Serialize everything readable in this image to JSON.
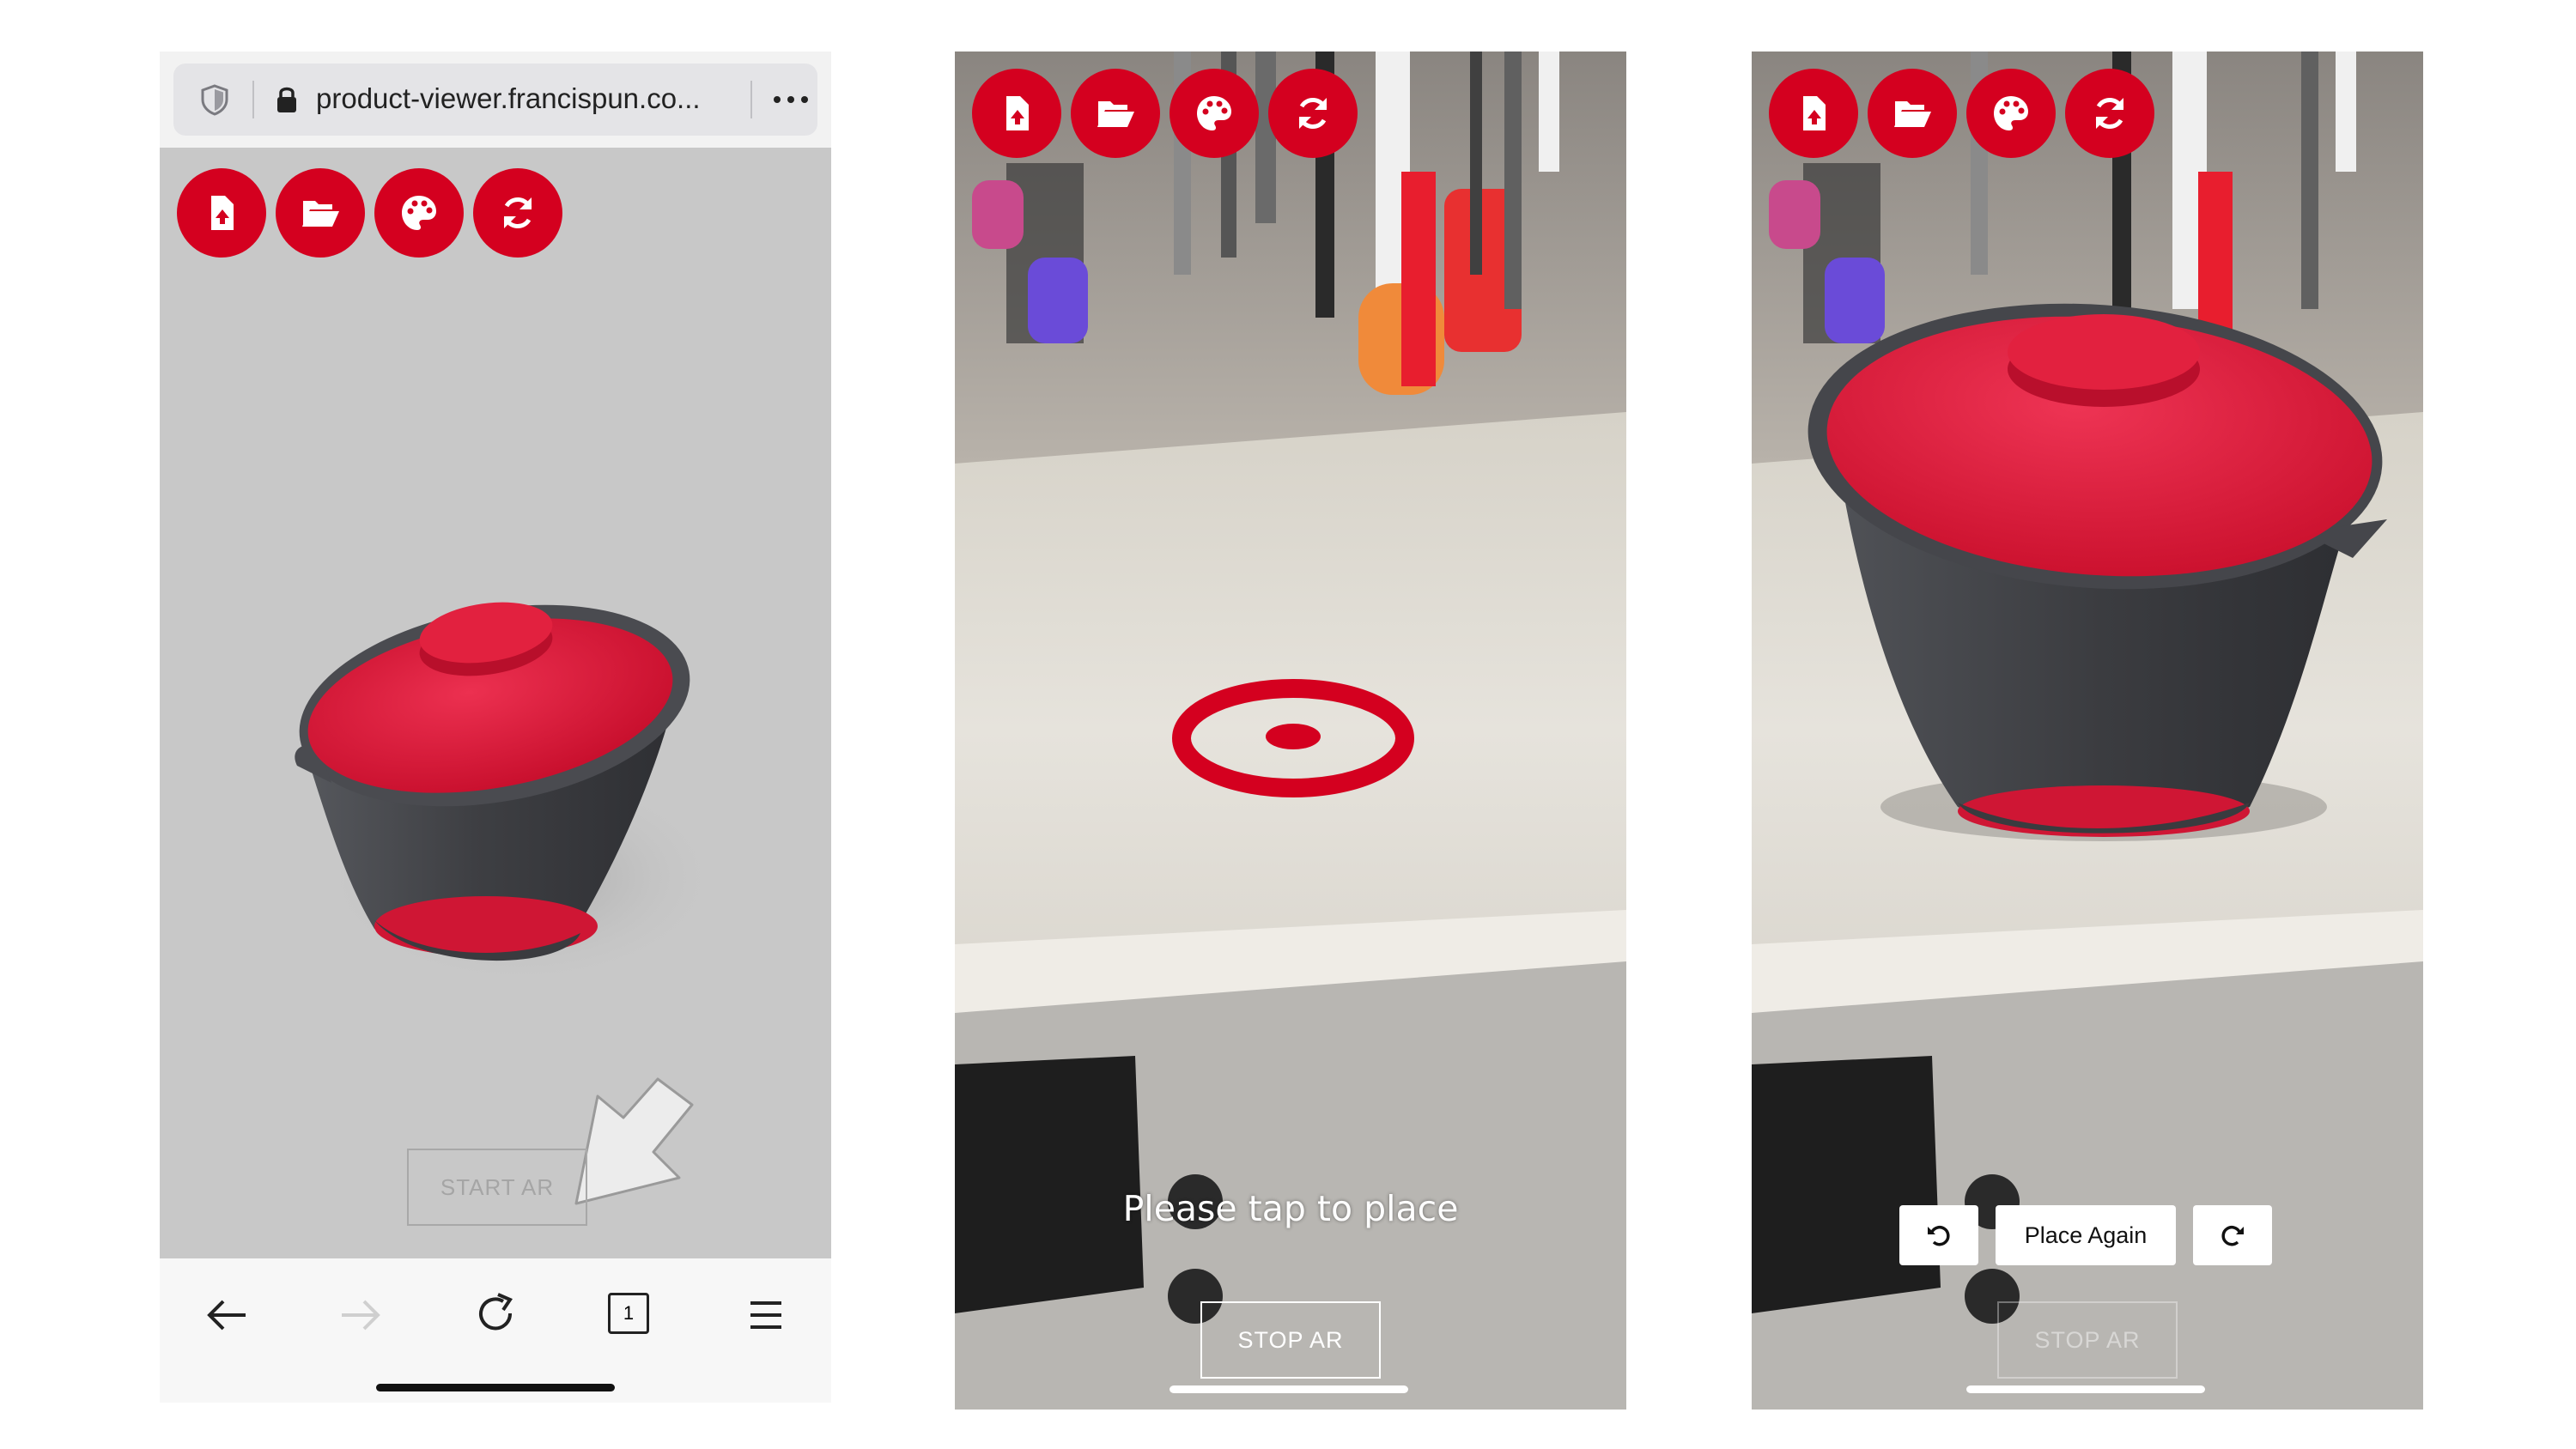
{
  "phone1": {
    "browser": {
      "url": "product-viewer.francispun.co...",
      "shield_icon": "shield-icon",
      "lock_icon": "lock-icon",
      "more_icon": "more-icon"
    },
    "toolbar": {
      "buttons": [
        "upload-file-icon",
        "open-folder-icon",
        "palette-icon",
        "refresh-icon"
      ]
    },
    "start_ar_label": "START AR",
    "bottom_nav": {
      "back_icon": "back-arrow-icon",
      "forward_icon": "forward-arrow-icon",
      "reload_icon": "reload-icon",
      "tabs_count": "1",
      "menu_icon": "menu-icon"
    }
  },
  "phone2": {
    "instruction": "Please tap to place",
    "stop_ar_label": "STOP AR",
    "reticle_color": "#d4001f"
  },
  "phone3": {
    "rotate_left_icon": "rotate-left-icon",
    "place_again_label": "Place Again",
    "rotate_right_icon": "rotate-right-icon",
    "stop_ar_label": "STOP AR"
  },
  "colors": {
    "accent": "#d4001f",
    "viewer_bg": "#c8c8c8",
    "pot_body": "#3f4044",
    "pot_lid": "#e2213f"
  }
}
